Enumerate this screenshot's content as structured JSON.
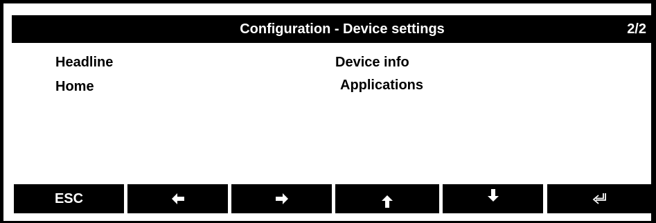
{
  "header": {
    "title": "Configuration - Device settings",
    "page": "2/2"
  },
  "menu": {
    "items": [
      {
        "label": "Headline"
      },
      {
        "label": "Home"
      },
      {
        "label": "Device info"
      },
      {
        "label": "Applications"
      }
    ]
  },
  "softkeys": {
    "esc_label": "ESC",
    "left_icon": "arrow-left-icon",
    "right_icon": "arrow-right-icon",
    "up_icon": "arrow-up-icon",
    "down_icon": "arrow-down-icon",
    "enter_icon": "enter-return-icon"
  },
  "colors": {
    "background": "#ffffff",
    "bar": "#000000",
    "bar_text": "#ffffff",
    "text": "#000000"
  }
}
